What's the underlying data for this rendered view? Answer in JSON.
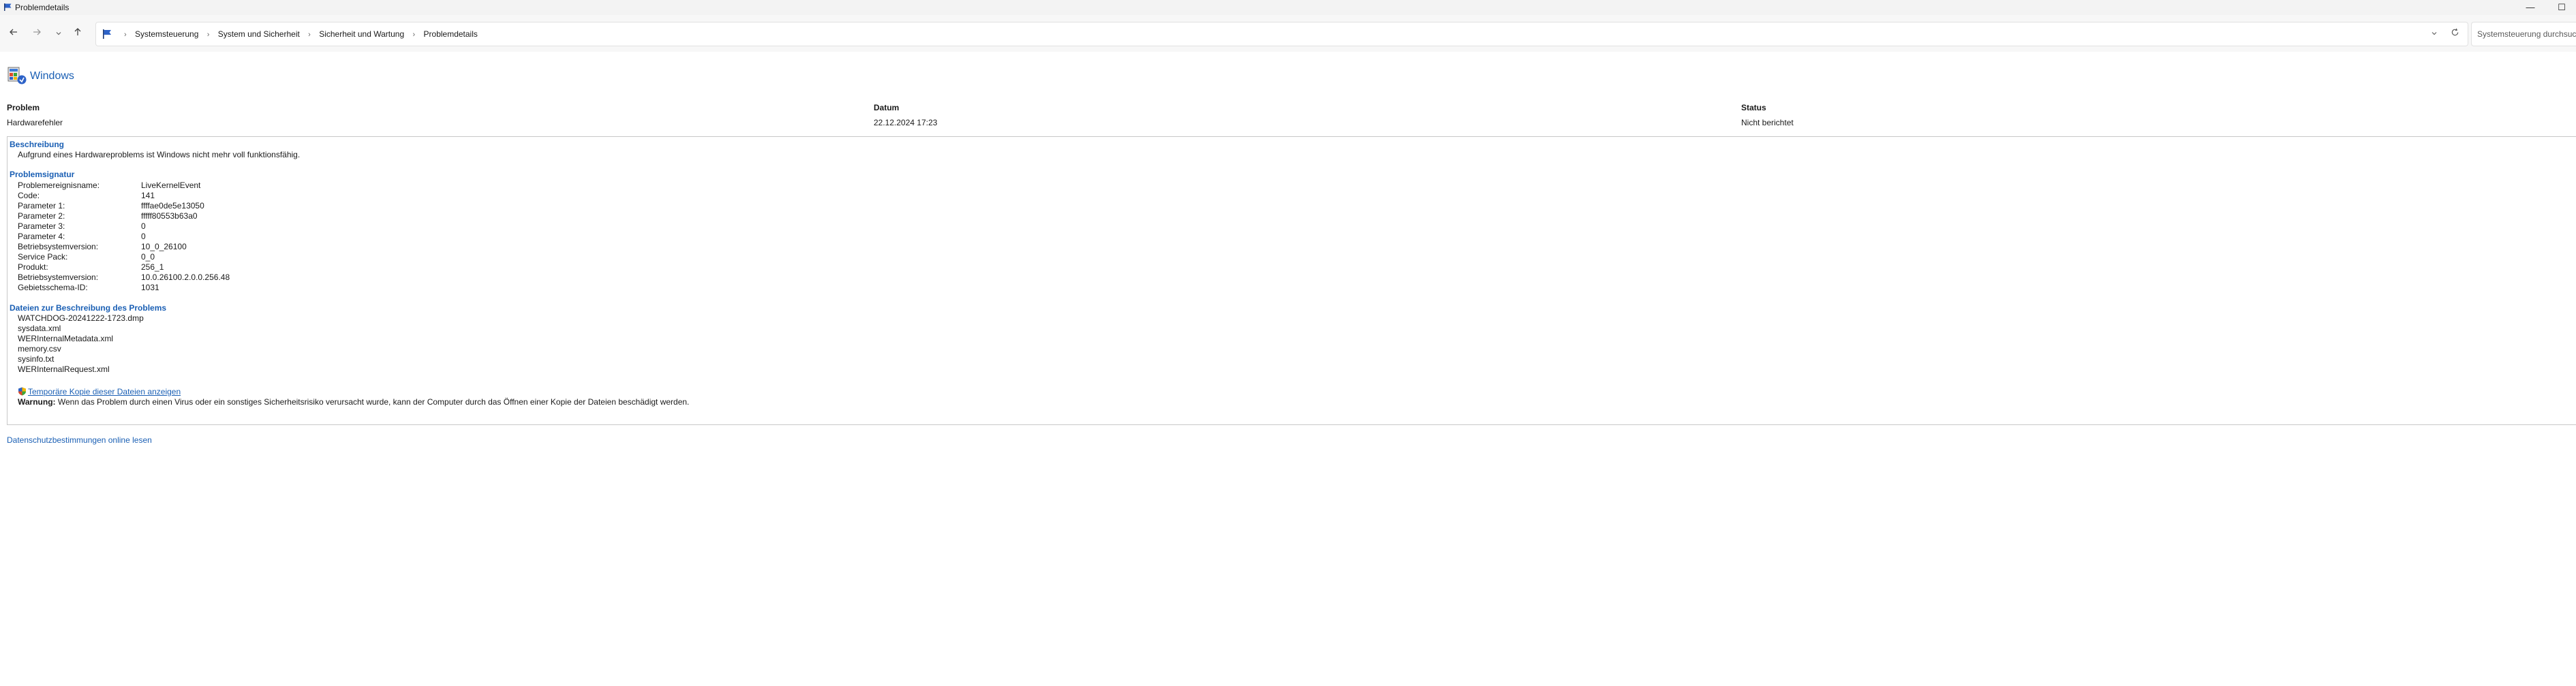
{
  "window": {
    "title": "Problemdetails",
    "minimize_glyph": "—",
    "maximize_glyph": "☐"
  },
  "nav": {
    "back_icon": "arrow-left-icon",
    "forward_icon": "arrow-right-icon",
    "recent_icon": "chevron-down-icon",
    "up_icon": "arrow-up-icon"
  },
  "breadcrumb": [
    "Systemsteuerung",
    "System und Sicherheit",
    "Sicherheit und Wartung",
    "Problemdetails"
  ],
  "search": {
    "placeholder": "Systemsteuerung durchsuchen"
  },
  "header": {
    "product": "Windows"
  },
  "columns": {
    "problem_label": "Problem",
    "problem_value": "Hardwarefehler",
    "date_label": "Datum",
    "date_value": "22.12.2024 17:23",
    "status_label": "Status",
    "status_value": "Nicht berichtet"
  },
  "description": {
    "title": "Beschreibung",
    "text": "Aufgrund eines Hardwareproblems ist Windows nicht mehr voll funktionsfähig."
  },
  "signature": {
    "title": "Problemsignatur",
    "rows": [
      {
        "label": "Problemereignisname:",
        "value": "LiveKernelEvent"
      },
      {
        "label": "Code:",
        "value": "141"
      },
      {
        "label": "Parameter 1:",
        "value": "ffffae0de5e13050"
      },
      {
        "label": "Parameter 2:",
        "value": "fffff80553b63a0"
      },
      {
        "label": "Parameter 3:",
        "value": "0"
      },
      {
        "label": "Parameter 4:",
        "value": "0"
      },
      {
        "label": "Betriebsystemversion:",
        "value": "10_0_26100"
      },
      {
        "label": "Service Pack:",
        "value": "0_0"
      },
      {
        "label": "Produkt:",
        "value": "256_1"
      },
      {
        "label": "Betriebsystemversion:",
        "value": "10.0.26100.2.0.0.256.48"
      },
      {
        "label": "Gebietsschema-ID:",
        "value": "1031"
      }
    ]
  },
  "files": {
    "title": "Dateien zur Beschreibung des Problems",
    "items": [
      "WATCHDOG-20241222-1723.dmp",
      "sysdata.xml",
      "WERInternalMetadata.xml",
      "memory.csv",
      "sysinfo.txt",
      "WERInternalRequest.xml"
    ],
    "temp_link": "Temporäre Kopie dieser Dateien anzeigen",
    "warning_label": "Warnung:",
    "warning_text": " Wenn das Problem durch einen Virus oder ein sonstiges Sicherheitsrisiko verursacht wurde, kann der Computer durch das Öffnen einer Kopie der Dateien beschädigt werden."
  },
  "footer": {
    "privacy_link": "Datenschutzbestimmungen online lesen"
  },
  "colors": {
    "link": "#1a5fb4",
    "titlebar": "#f3f3f3",
    "border": "#c8c8c8"
  }
}
